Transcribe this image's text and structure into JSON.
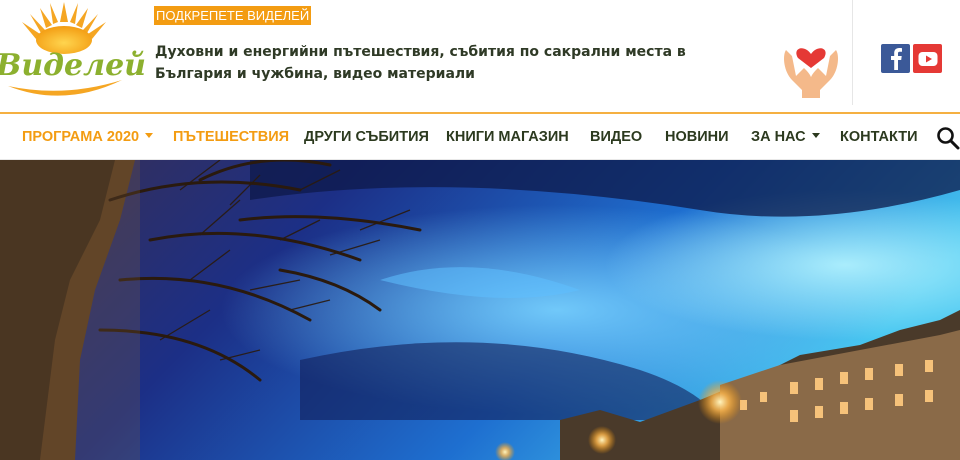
{
  "brand": {
    "name": "Виделей"
  },
  "header": {
    "support_badge": "ПОДКРЕПЕТЕ ВИДЕЛЕЙ",
    "tagline": "Духовни и енергийни пътешествия, събития по сакрални места в България и чужбина, видео материали",
    "icons": [
      "sun-logo-icon",
      "donation-hands-icon",
      "facebook-icon",
      "youtube-icon"
    ]
  },
  "nav": {
    "items": [
      {
        "label": "ПРОГРАМА 2020",
        "has_dropdown": true,
        "active": true
      },
      {
        "label": "ПЪТЕШЕСТВИЯ",
        "has_dropdown": false,
        "active": true
      },
      {
        "label": "ДРУГИ СЪБИТИЯ",
        "has_dropdown": false,
        "active": false
      },
      {
        "label": "КНИГИ МАГАЗИН",
        "has_dropdown": false,
        "active": false
      },
      {
        "label": "ВИДЕО",
        "has_dropdown": false,
        "active": false
      },
      {
        "label": "НОВИНИ",
        "has_dropdown": false,
        "active": false
      },
      {
        "label": "ЗА НАС",
        "has_dropdown": true,
        "active": false
      },
      {
        "label": "КОНТАКТИ",
        "has_dropdown": false,
        "active": false
      }
    ],
    "search_icon": "search-icon"
  },
  "colors": {
    "accent": "#f39c12",
    "logo_green": "#8cb02f",
    "nav_text": "#2c3a1f",
    "facebook": "#3b5998",
    "youtube": "#e53935"
  }
}
